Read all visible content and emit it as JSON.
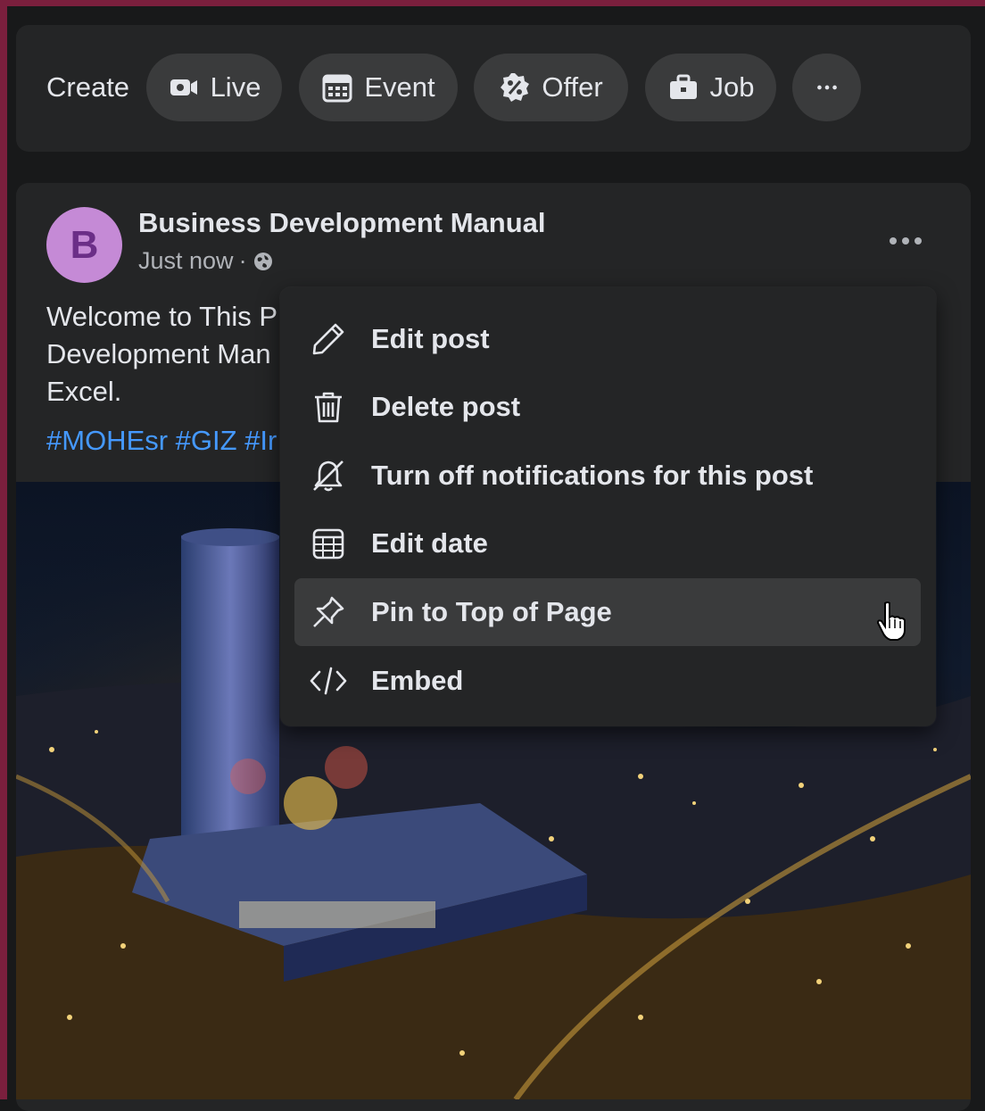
{
  "create_bar": {
    "label": "Create",
    "actions": [
      {
        "label": "Live",
        "icon": "live-video-icon"
      },
      {
        "label": "Event",
        "icon": "calendar-icon"
      },
      {
        "label": "Offer",
        "icon": "offer-percent-icon"
      },
      {
        "label": "Job",
        "icon": "briefcase-icon"
      },
      {
        "label": "",
        "icon": "more-horizontal-icon"
      }
    ]
  },
  "post": {
    "avatar_letter": "B",
    "page_name": "Business Development Manual",
    "timestamp": "Just now",
    "audience_icon": "globe-icon",
    "text_line1": "Welcome to This P",
    "text_line2": "Development Man",
    "text_line3": "Excel.",
    "hashtags": "#MOHEsr #GIZ #Ir"
  },
  "menu": {
    "items": [
      {
        "label": "Edit post",
        "icon": "pencil-icon"
      },
      {
        "label": "Delete post",
        "icon": "trash-icon"
      },
      {
        "label": "Turn off notifications for this post",
        "icon": "bell-off-icon"
      },
      {
        "label": "Edit date",
        "icon": "calendar-icon"
      },
      {
        "label": "Pin to Top of Page",
        "icon": "pin-icon",
        "highlighted": true
      },
      {
        "label": "Embed",
        "icon": "code-icon"
      }
    ]
  },
  "colors": {
    "background": "#18191a",
    "card": "#242526",
    "chip": "#3a3b3c",
    "text_primary": "#e4e6eb",
    "text_secondary": "#b0b3b8",
    "hashtag": "#4599ff",
    "avatar_bg": "#c58ad6",
    "frame": "#7a1f3d"
  }
}
